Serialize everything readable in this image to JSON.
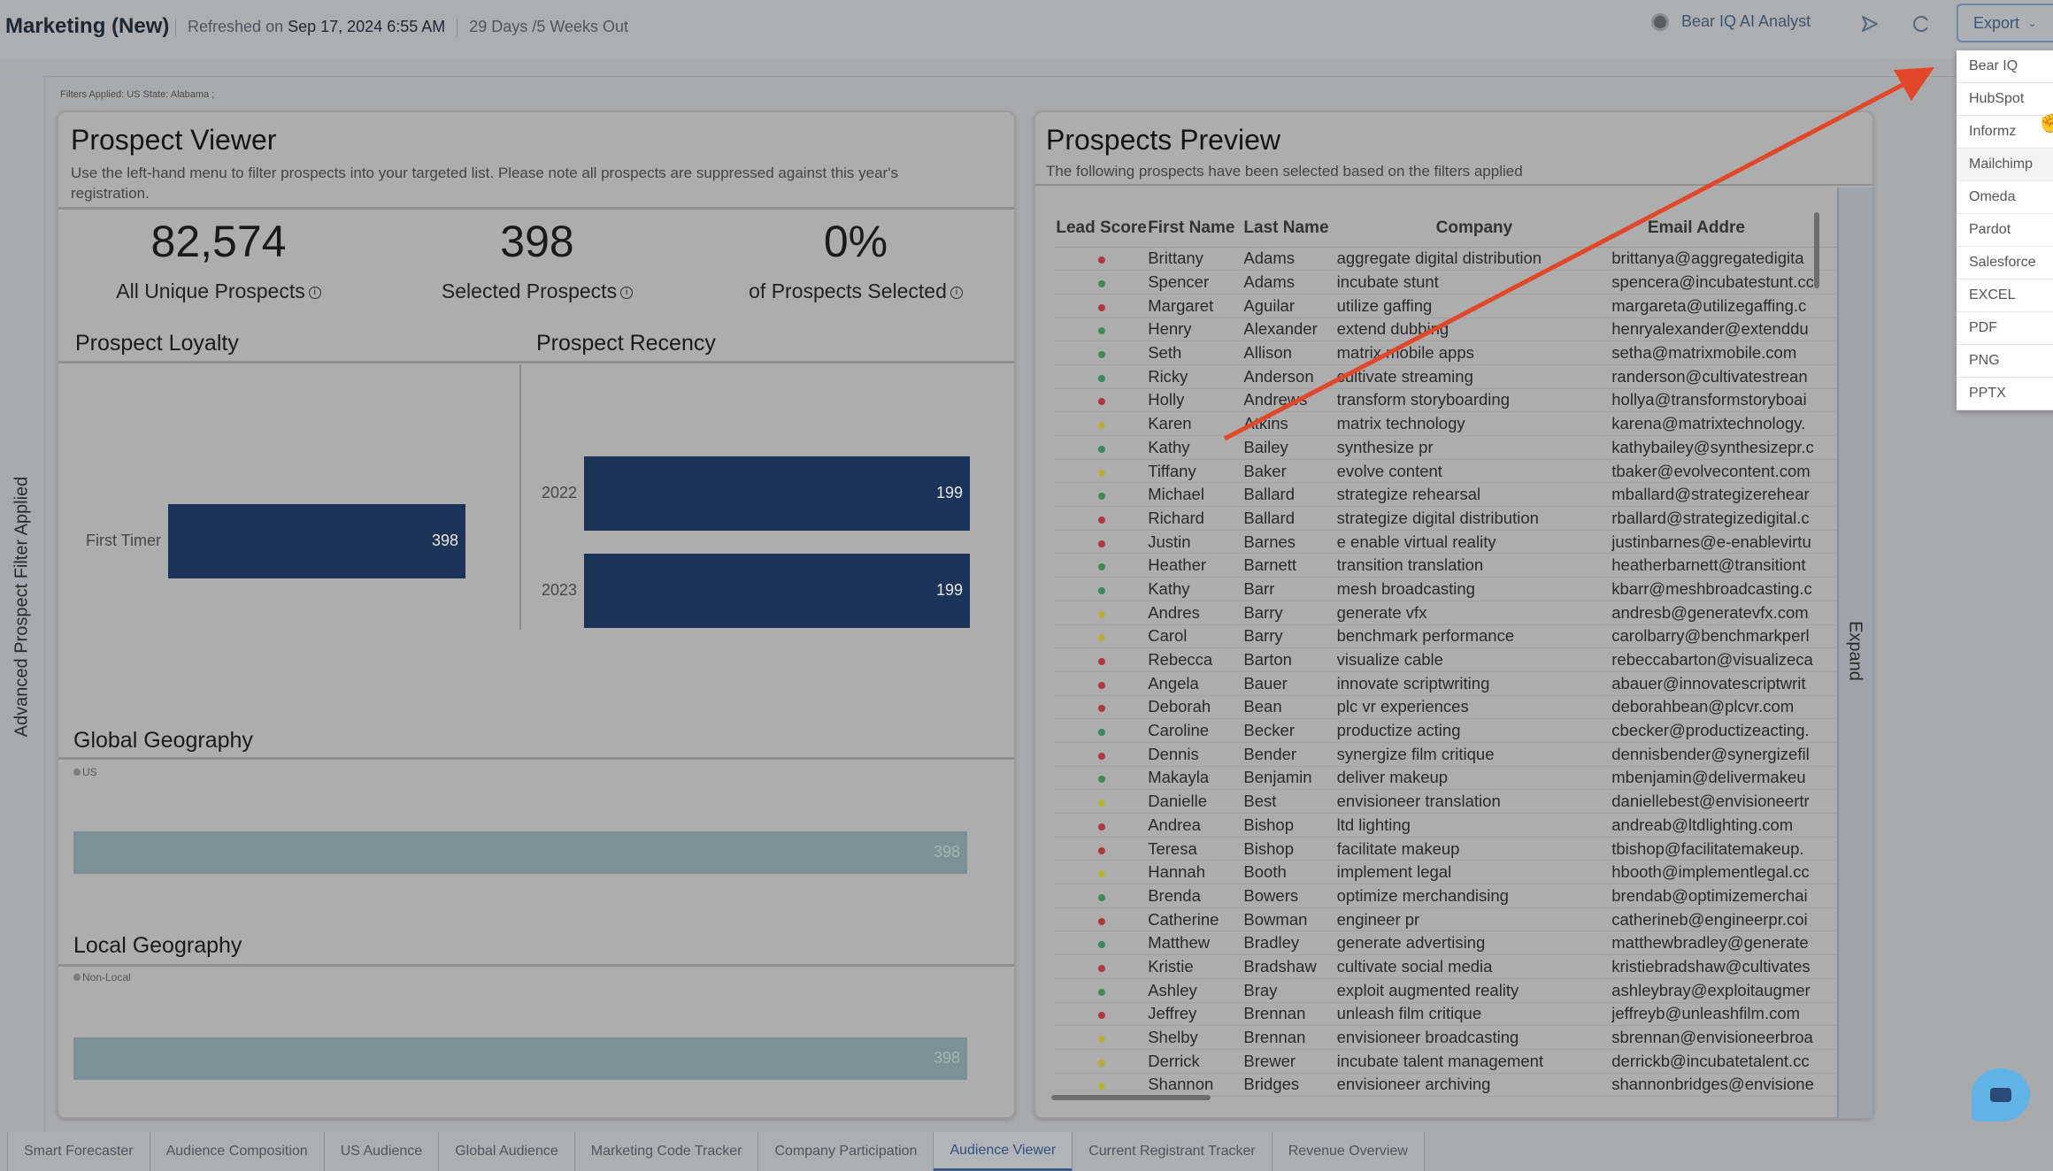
{
  "header": {
    "title": "Marketing (New)",
    "refreshed_label": "Refreshed on",
    "refreshed_value": "Sep 17, 2024 6:55 AM",
    "countdown": "29 Days /5 Weeks Out",
    "ai_analyst": "Bear IQ AI Analyst",
    "export_label": "Export"
  },
  "export_menu": [
    "Bear IQ",
    "HubSpot",
    "Informz",
    "Mailchimp",
    "Omeda",
    "Pardot",
    "Salesforce",
    "EXCEL",
    "PDF",
    "PNG",
    "PPTX"
  ],
  "filters_applied": "Filters Applied:  US State: Alabama ;",
  "sidebar_label": "Advanced Prospect Filter Applied",
  "prospect_viewer": {
    "title": "Prospect Viewer",
    "description": "Use the left-hand menu to filter prospects into your targeted list. Please note all prospects are suppressed against this year's registration.",
    "kpis": [
      {
        "value": "82,574",
        "label": "All Unique Prospects"
      },
      {
        "value": "398",
        "label": "Selected Prospects"
      },
      {
        "value": "0%",
        "label": "of Prospects Selected"
      }
    ]
  },
  "chart_data": [
    {
      "type": "bar",
      "title": "Prospect Loyalty",
      "orientation": "horizontal",
      "categories": [
        "First Timer"
      ],
      "values": [
        398
      ],
      "xlim": [
        0,
        398
      ]
    },
    {
      "type": "bar",
      "title": "Prospect Recency",
      "orientation": "horizontal",
      "categories": [
        "2022",
        "2023"
      ],
      "values": [
        199,
        199
      ],
      "xlim": [
        0,
        199
      ]
    },
    {
      "type": "bar",
      "title": "Global Geography",
      "orientation": "horizontal",
      "legend": [
        "US"
      ],
      "categories": [
        "US"
      ],
      "values": [
        398
      ],
      "xlim": [
        0,
        398
      ]
    },
    {
      "type": "bar",
      "title": "Local Geography",
      "orientation": "horizontal",
      "legend": [
        "Non-Local"
      ],
      "categories": [
        "Non-Local"
      ],
      "values": [
        398
      ],
      "xlim": [
        0,
        398
      ]
    }
  ],
  "prospects_preview": {
    "title": "Prospects Preview",
    "description": "The following prospects have been selected based on the filters applied",
    "columns": [
      "Lead Score",
      "First Name",
      "Last Name",
      "Company",
      "Email Addre"
    ],
    "expand_label": "Expand",
    "score_colors": {
      "red": "#b0383a",
      "green": "#3f8a5a",
      "yellow": "#b6b034"
    },
    "rows": [
      {
        "score": "red",
        "first": "Brittany",
        "last": "Adams",
        "company": "aggregate digital distribution",
        "email": "brittanya@aggregatedigita"
      },
      {
        "score": "green",
        "first": "Spencer",
        "last": "Adams",
        "company": "incubate stunt",
        "email": "spencera@incubatestunt.cc"
      },
      {
        "score": "red",
        "first": "Margaret",
        "last": "Aguilar",
        "company": "utilize gaffing",
        "email": "margareta@utilizegaffing.c"
      },
      {
        "score": "green",
        "first": "Henry",
        "last": "Alexander",
        "company": "extend dubbing",
        "email": "henryalexander@extenddu"
      },
      {
        "score": "green",
        "first": "Seth",
        "last": "Allison",
        "company": "matrix mobile apps",
        "email": "setha@matrixmobile.com"
      },
      {
        "score": "green",
        "first": "Ricky",
        "last": "Anderson",
        "company": "cultivate streaming",
        "email": "randerson@cultivatestrean"
      },
      {
        "score": "red",
        "first": "Holly",
        "last": "Andrews",
        "company": "transform storyboarding",
        "email": "hollya@transformstoryboai"
      },
      {
        "score": "yellow",
        "first": "Karen",
        "last": "Atkins",
        "company": "matrix technology",
        "email": "karena@matrixtechnology."
      },
      {
        "score": "green",
        "first": "Kathy",
        "last": "Bailey",
        "company": "synthesize pr",
        "email": "kathybailey@synthesizepr.c"
      },
      {
        "score": "yellow",
        "first": "Tiffany",
        "last": "Baker",
        "company": "evolve content",
        "email": "tbaker@evolvecontent.com"
      },
      {
        "score": "green",
        "first": "Michael",
        "last": "Ballard",
        "company": "strategize rehearsal",
        "email": "mballard@strategizerehear"
      },
      {
        "score": "red",
        "first": "Richard",
        "last": "Ballard",
        "company": "strategize digital distribution",
        "email": "rballard@strategizedigital.c"
      },
      {
        "score": "red",
        "first": "Justin",
        "last": "Barnes",
        "company": "e enable virtual reality",
        "email": "justinbarnes@e-enablevirtu"
      },
      {
        "score": "green",
        "first": "Heather",
        "last": "Barnett",
        "company": "transition translation",
        "email": "heatherbarnett@transitiont"
      },
      {
        "score": "green",
        "first": "Kathy",
        "last": "Barr",
        "company": "mesh broadcasting",
        "email": "kbarr@meshbroadcasting.c"
      },
      {
        "score": "yellow",
        "first": "Andres",
        "last": "Barry",
        "company": "generate vfx",
        "email": "andresb@generatevfx.com"
      },
      {
        "score": "yellow",
        "first": "Carol",
        "last": "Barry",
        "company": "benchmark performance",
        "email": "carolbarry@benchmarkperl"
      },
      {
        "score": "red",
        "first": "Rebecca",
        "last": "Barton",
        "company": "visualize cable",
        "email": "rebeccabarton@visualizeca"
      },
      {
        "score": "red",
        "first": "Angela",
        "last": "Bauer",
        "company": "innovate scriptwriting",
        "email": "abauer@innovatescriptwrit"
      },
      {
        "score": "red",
        "first": "Deborah",
        "last": "Bean",
        "company": "plc vr experiences",
        "email": "deborahbean@plcvr.com"
      },
      {
        "score": "green",
        "first": "Caroline",
        "last": "Becker",
        "company": "productize acting",
        "email": "cbecker@productizeacting."
      },
      {
        "score": "red",
        "first": "Dennis",
        "last": "Bender",
        "company": "synergize film critique",
        "email": "dennisbender@synergizefil"
      },
      {
        "score": "green",
        "first": "Makayla",
        "last": "Benjamin",
        "company": "deliver makeup",
        "email": "mbenjamin@delivermakeu"
      },
      {
        "score": "yellow",
        "first": "Danielle",
        "last": "Best",
        "company": "envisioneer translation",
        "email": "daniellebest@envisioneertr"
      },
      {
        "score": "red",
        "first": "Andrea",
        "last": "Bishop",
        "company": "ltd lighting",
        "email": "andreab@ltdlighting.com"
      },
      {
        "score": "red",
        "first": "Teresa",
        "last": "Bishop",
        "company": "facilitate makeup",
        "email": "tbishop@facilitatemakeup."
      },
      {
        "score": "yellow",
        "first": "Hannah",
        "last": "Booth",
        "company": "implement legal",
        "email": "hbooth@implementlegal.cc"
      },
      {
        "score": "green",
        "first": "Brenda",
        "last": "Bowers",
        "company": "optimize merchandising",
        "email": "brendab@optimizemerchai"
      },
      {
        "score": "red",
        "first": "Catherine",
        "last": "Bowman",
        "company": "engineer pr",
        "email": "catherineb@engineerpr.coi"
      },
      {
        "score": "green",
        "first": "Matthew",
        "last": "Bradley",
        "company": "generate advertising",
        "email": "matthewbradley@generate"
      },
      {
        "score": "red",
        "first": "Kristie",
        "last": "Bradshaw",
        "company": "cultivate social media",
        "email": "kristiebradshaw@cultivates"
      },
      {
        "score": "green",
        "first": "Ashley",
        "last": "Bray",
        "company": "exploit augmented reality",
        "email": "ashleybray@exploitaugmer"
      },
      {
        "score": "red",
        "first": "Jeffrey",
        "last": "Brennan",
        "company": "unleash film critique",
        "email": "jeffreyb@unleashfilm.com"
      },
      {
        "score": "yellow",
        "first": "Shelby",
        "last": "Brennan",
        "company": "envisioneer broadcasting",
        "email": "sbrennan@envisioneerbroa"
      },
      {
        "score": "yellow",
        "first": "Derrick",
        "last": "Brewer",
        "company": "incubate talent management",
        "email": "derrickb@incubatetalent.cc"
      },
      {
        "score": "yellow",
        "first": "Shannon",
        "last": "Bridges",
        "company": "envisioneer archiving",
        "email": "shannonbridges@envisione"
      }
    ]
  },
  "tabs": [
    {
      "label": "Smart Forecaster",
      "active": false
    },
    {
      "label": "Audience Composition",
      "active": false
    },
    {
      "label": "US Audience",
      "active": false
    },
    {
      "label": "Global Audience",
      "active": false
    },
    {
      "label": "Marketing Code Tracker",
      "active": false
    },
    {
      "label": "Company Participation",
      "active": false
    },
    {
      "label": "Audience Viewer",
      "active": true
    },
    {
      "label": "Current Registrant Tracker",
      "active": false
    },
    {
      "label": "Revenue Overview",
      "active": false
    }
  ]
}
